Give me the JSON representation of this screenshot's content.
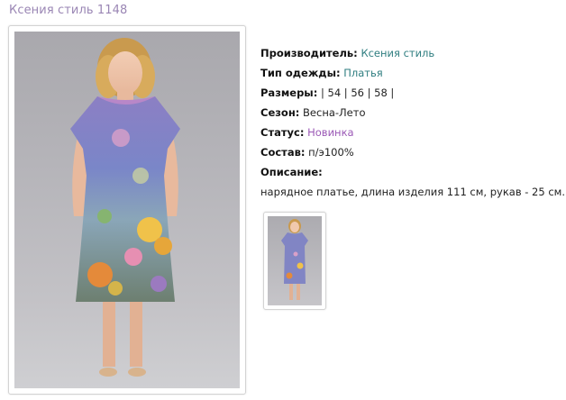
{
  "page": {
    "title": "Ксения стиль 1148"
  },
  "product": {
    "manufacturer_label": "Производитель:",
    "manufacturer_value": "Ксения стиль",
    "type_label": "Тип одежды:",
    "type_value": "Платья",
    "sizes_label": "Размеры:",
    "sizes_value": "| 54 | 56 | 58 |",
    "season_label": "Сезон:",
    "season_value": "Весна-Лето",
    "status_label": "Статус:",
    "status_value": "Новинка",
    "composition_label": "Состав:",
    "composition_value": "п/э100%",
    "description_label": "Описание:",
    "description_value": "нарядное платье, длина изделия 111 см, рукав - 25 см."
  },
  "colors": {
    "title": "#9a86b4",
    "link": "#2f7e80",
    "status": "#9b59b6"
  },
  "images": {
    "main_photo": "dress-model-photo",
    "thumbnail": "dress-thumbnail"
  }
}
